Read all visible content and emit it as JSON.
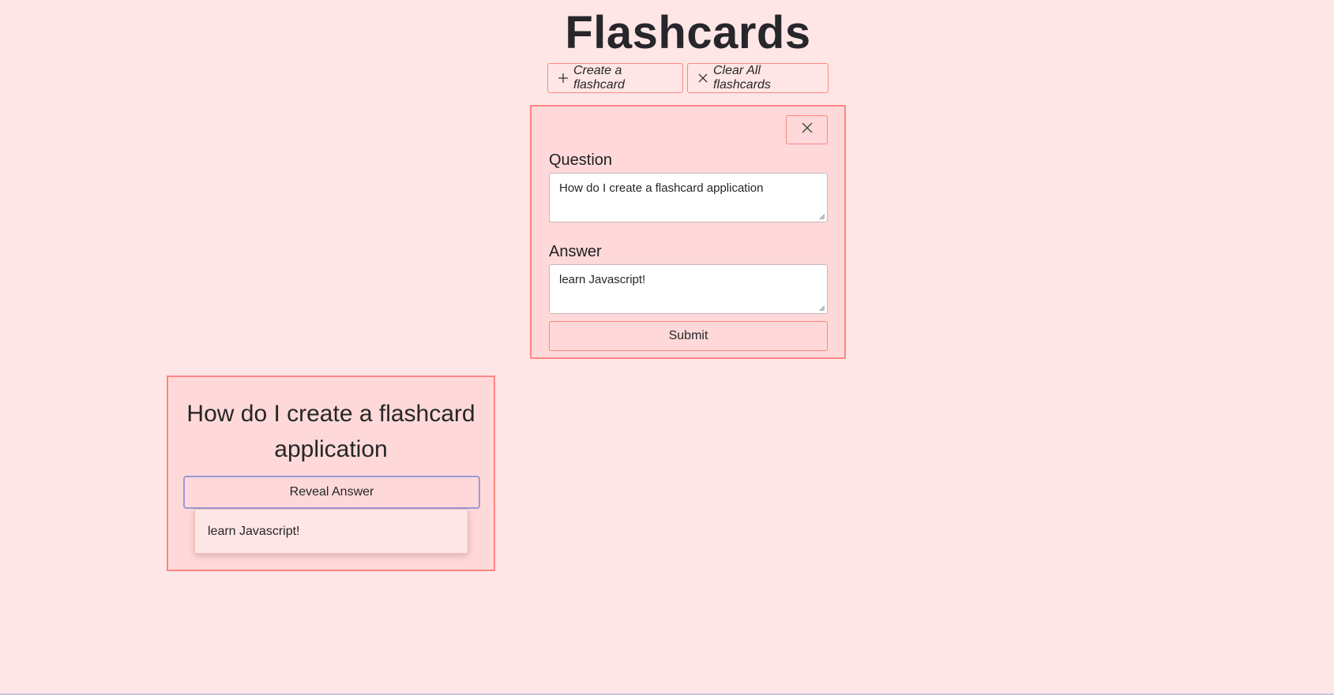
{
  "header": {
    "title": "Flashcards"
  },
  "toolbar": {
    "create_label": "Create a flashcard",
    "create_icon": "plus-icon",
    "clear_label": "Clear All flashcards",
    "clear_icon": "close-icon"
  },
  "form": {
    "close_icon": "close-icon",
    "question_label": "Question",
    "question_value": "How do I create a flashcard application",
    "answer_label": "Answer",
    "answer_value": "learn Javascript!",
    "submit_label": "Submit"
  },
  "cards": [
    {
      "question": "How do I create a flashcard application",
      "reveal_label": "Reveal Answer",
      "answer": "learn Javascript!"
    }
  ],
  "colors": {
    "background": "#ffe6e6",
    "panel": "#ffd9d9",
    "accent_border": "#ff8585",
    "focus_ring": "#9a9ad8"
  }
}
